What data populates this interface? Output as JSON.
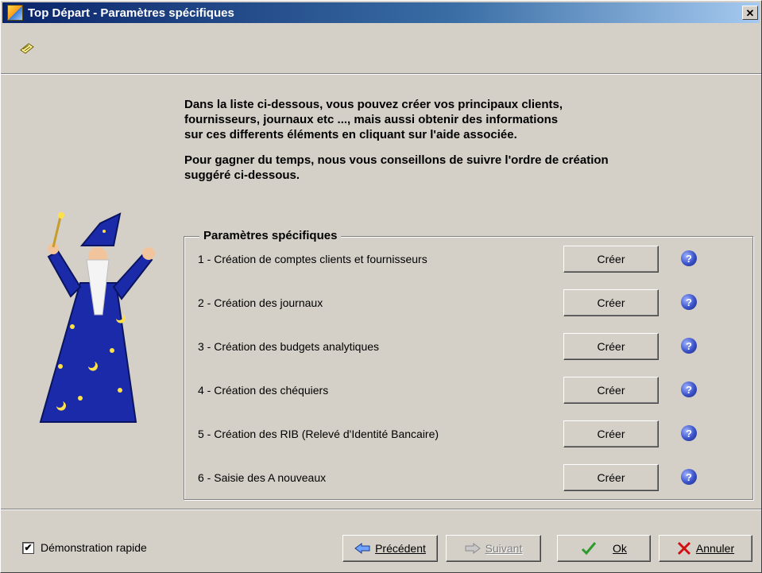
{
  "window": {
    "title": "Top Départ - Paramètres spécifiques",
    "close_glyph": "✕"
  },
  "intro": {
    "line1": "Dans la liste ci-dessous, vous pouvez créer vos principaux clients,",
    "line2": "fournisseurs, journaux etc ..., mais aussi obtenir des informations",
    "line3": "sur ces differents éléments en cliquant sur l'aide associée.",
    "line4": "Pour gagner du temps, nous vous conseillons de suivre l'ordre de création",
    "line5": "suggéré ci-dessous."
  },
  "group": {
    "title": "Paramètres spécifiques",
    "rows": [
      {
        "label": "1 - Création de comptes clients et fournisseurs",
        "button": "Créer"
      },
      {
        "label": "2 - Création des journaux",
        "button": "Créer"
      },
      {
        "label": "3 - Création des budgets analytiques",
        "button": "Créer"
      },
      {
        "label": "4 - Création des chéquiers",
        "button": "Créer"
      },
      {
        "label": "5 - Création des RIB (Relevé d'Identité Bancaire)",
        "button": "Créer"
      },
      {
        "label": "6 - Saisie des A nouveaux",
        "button": "Créer"
      }
    ],
    "help_glyph": "?"
  },
  "footer": {
    "demo_label": "Démonstration rapide",
    "demo_checked_glyph": "✔",
    "prev_label": "Précédent",
    "next_label": "Suivant",
    "ok_label": "Ok",
    "cancel_label": "Annuler"
  },
  "colors": {
    "titlebar": "#0a246a",
    "face": "#d4d0c8",
    "ok_check": "#2e9a2e",
    "cancel_x": "#d01010"
  }
}
